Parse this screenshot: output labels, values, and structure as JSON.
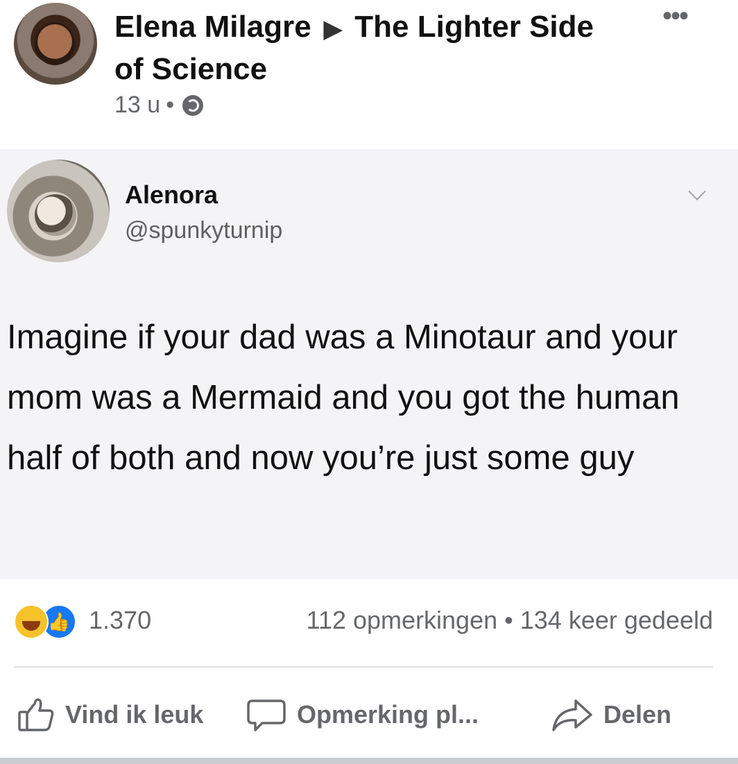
{
  "post": {
    "author": "Elena Milagre",
    "group": "The Lighter Side of Science",
    "time": "13 u",
    "separator": "•"
  },
  "tweet": {
    "name": "Alenora",
    "handle": "@spunkyturnip",
    "text": "Imagine if your dad was a Minotaur and your mom was a Mermaid and you got the human half of both and now you’re just some guy"
  },
  "stats": {
    "reaction_count": "1.370",
    "comments": "112 opmerkingen",
    "shares": "134 keer gedeeld",
    "separator": "•"
  },
  "actions": {
    "like": "Vind ik leuk",
    "comment": "Opmerking pl...",
    "share": "Delen"
  },
  "colors": {
    "secondary_text": "#65676b",
    "like_blue": "#1877f2",
    "haha_yellow": "#f7c229",
    "tweet_bg": "#f4f4f6"
  },
  "icons": [
    "globe-icon",
    "more-icon",
    "chevron-down-icon",
    "haha-reaction-icon",
    "like-reaction-icon",
    "thumbs-up-icon",
    "comment-icon",
    "share-icon"
  ]
}
